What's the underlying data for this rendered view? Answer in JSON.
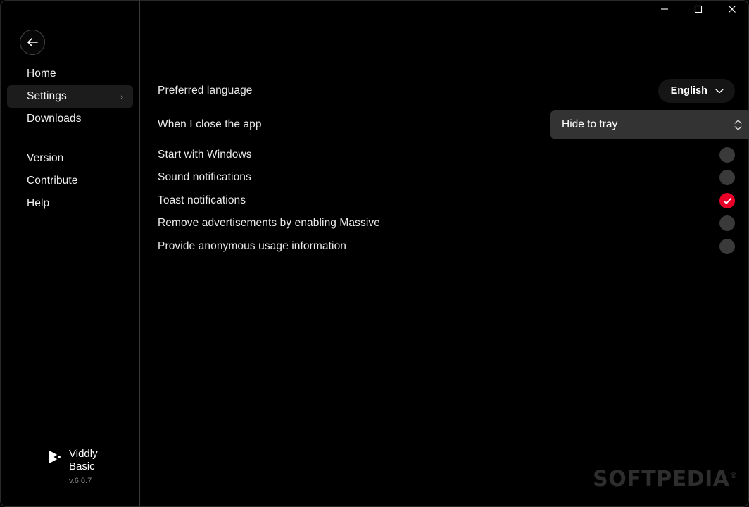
{
  "window": {
    "controls": [
      {
        "name": "minimize",
        "glyph": "minimize-icon"
      },
      {
        "name": "maximize",
        "glyph": "maximize-icon"
      },
      {
        "name": "close",
        "glyph": "close-icon"
      }
    ]
  },
  "sidebar": {
    "back_button": "back-arrow-icon",
    "items": [
      {
        "label": "Home",
        "active": false,
        "chevron": ""
      },
      {
        "label": "Settings",
        "active": true,
        "chevron": "›"
      },
      {
        "label": "Downloads",
        "active": false,
        "chevron": ""
      },
      {
        "label": "Version",
        "active": false,
        "chevron": ""
      },
      {
        "label": "Contribute",
        "active": false,
        "chevron": ""
      },
      {
        "label": "Help",
        "active": false,
        "chevron": ""
      }
    ],
    "brand": {
      "name": "Viddly Basic",
      "version": "v.6.0.7",
      "logo": "play-triangle-icon"
    }
  },
  "settings": {
    "language_row": {
      "label": "Preferred language",
      "value": "English"
    },
    "close_app_row": {
      "label": "When I close the app",
      "value": "Hide to tray"
    },
    "toggles": [
      {
        "label": "Start with Windows",
        "checked": false
      },
      {
        "label": "Sound notifications",
        "checked": false
      },
      {
        "label": "Toast notifications",
        "checked": true
      },
      {
        "label": "Remove advertisements by enabling Massive",
        "checked": false
      },
      {
        "label": "Provide anonymous usage information",
        "checked": false
      }
    ]
  },
  "watermark": {
    "text": "SOFTPEDIA",
    "mark": "®"
  },
  "colors": {
    "accent": "#e80029",
    "background": "#000000",
    "panel": "#333333",
    "active_nav": "#1c1c1c",
    "divider": "#3a3a3a"
  }
}
